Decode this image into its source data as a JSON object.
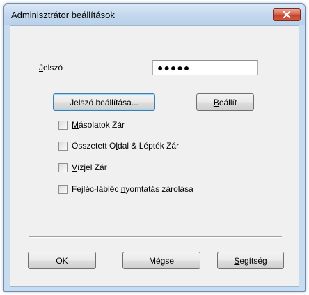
{
  "window": {
    "title": "Adminisztrátor beállítások"
  },
  "password": {
    "label_prefix": "",
    "label_mnemonic": "J",
    "label_rest": "elszó",
    "value": "●●●●●"
  },
  "buttons": {
    "set_password": "Jelszó beállítása...",
    "apply_mnemonic": "B",
    "apply_rest": "eállít"
  },
  "options": [
    {
      "mnemonic": "M",
      "rest": "ásolatok Zár",
      "prefix": "",
      "checked": false
    },
    {
      "prefix": "Összetett O",
      "mnemonic": "l",
      "rest": "dal & Lépték Zár",
      "checked": false
    },
    {
      "prefix": "",
      "mnemonic": "V",
      "rest": "ízjel Zár",
      "checked": false
    },
    {
      "prefix": "Fejléc-lábléc ",
      "mnemonic": "n",
      "rest": "yomtatás zárolása",
      "checked": false
    }
  ],
  "footer": {
    "ok": "OK",
    "cancel": "Mégse",
    "help_prefix": "",
    "help_mnemonic": "S",
    "help_rest": "egítség"
  },
  "colors": {
    "close_button": "#c5422b",
    "default_button_border": "#3c7fb1"
  }
}
